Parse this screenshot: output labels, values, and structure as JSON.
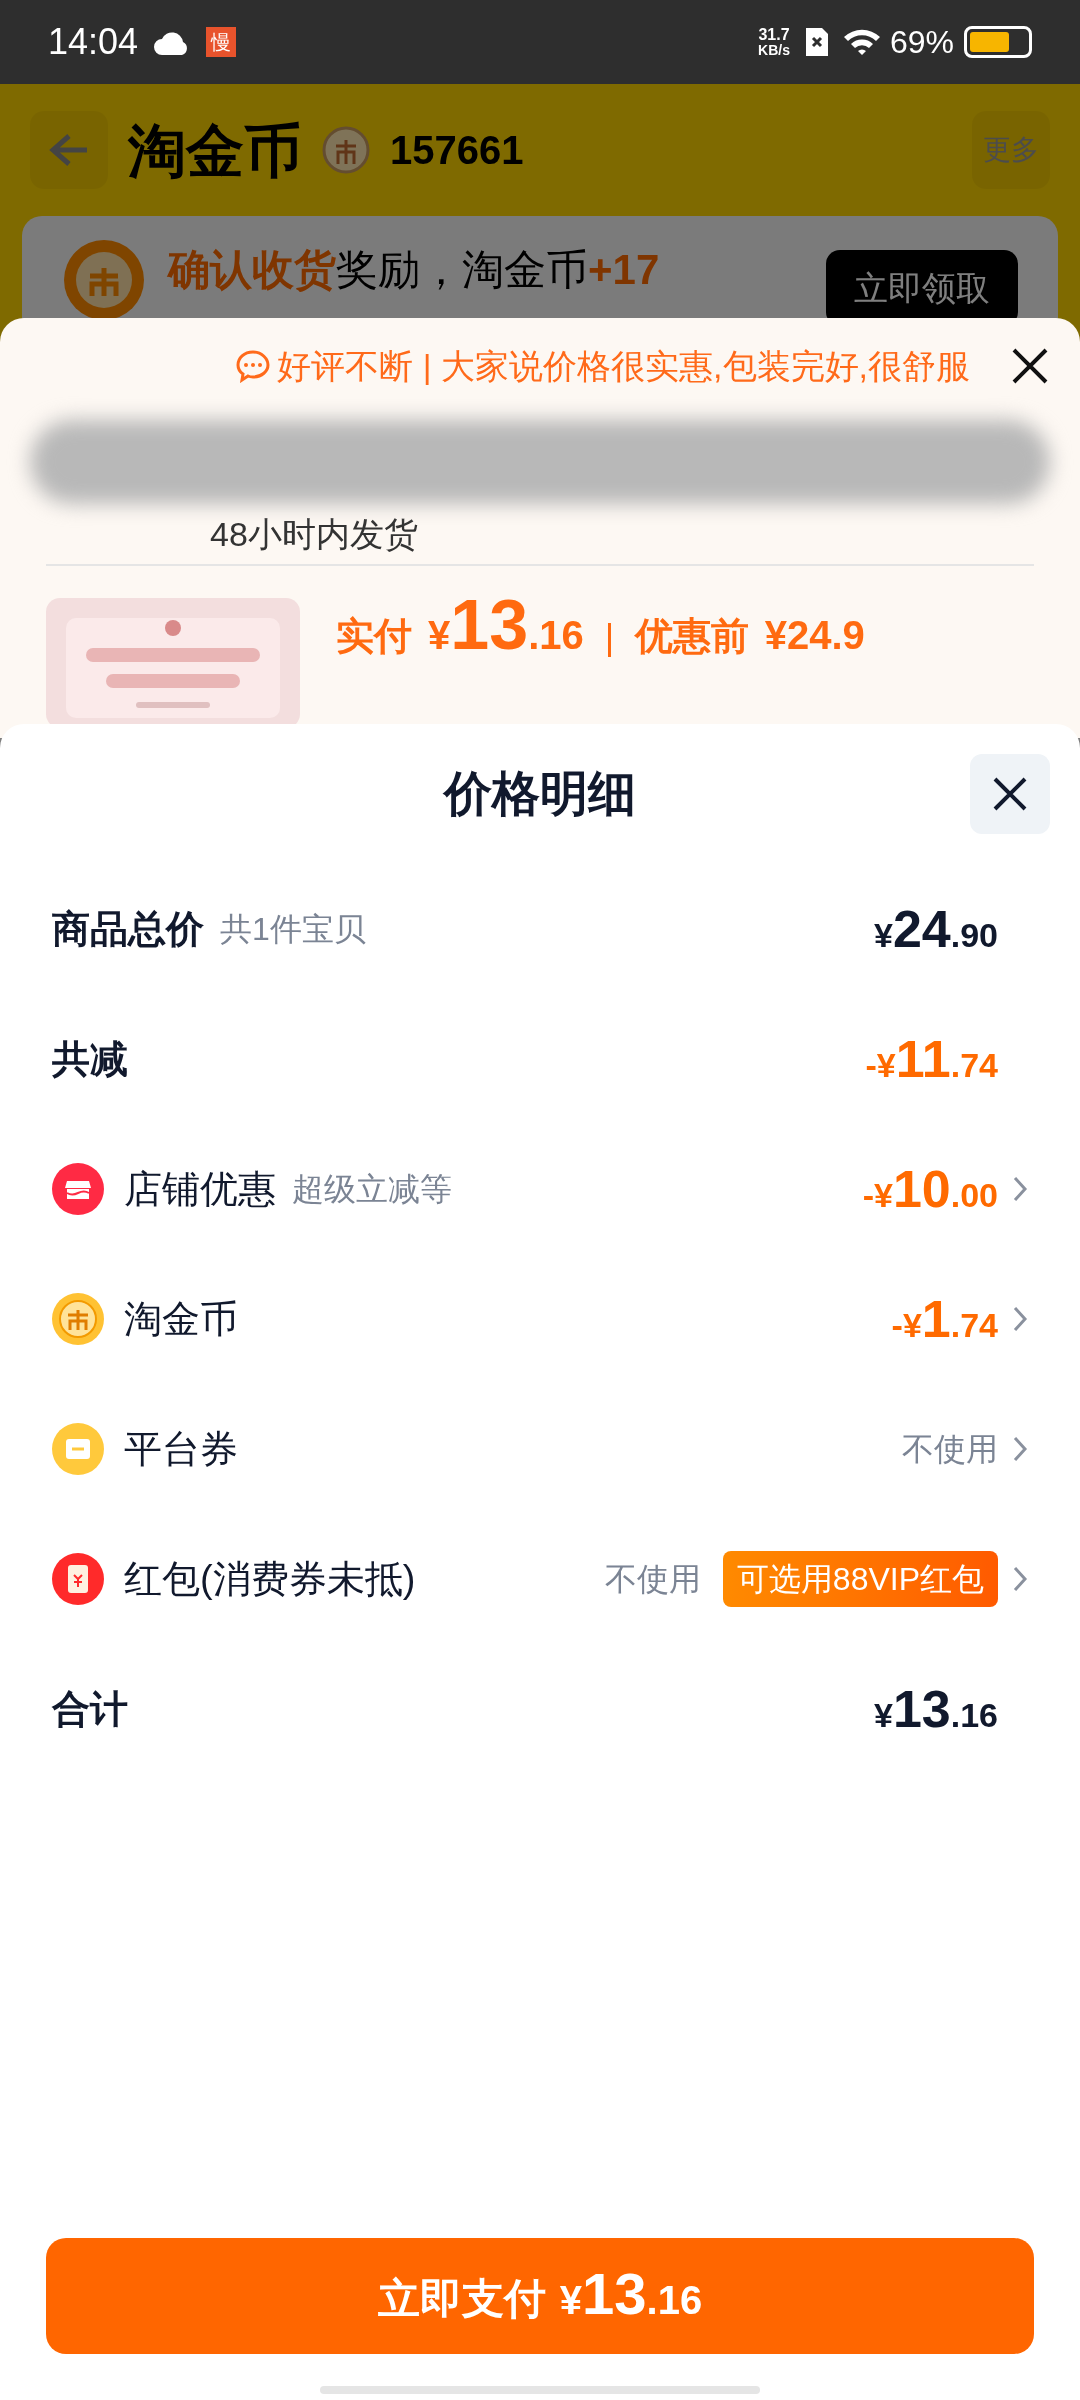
{
  "status_bar": {
    "time": "14:04",
    "app_badge": "慢",
    "net_speed": "31.7",
    "net_unit": "KB/s",
    "battery": "69%"
  },
  "page": {
    "title": "淘金币",
    "coins": "157661",
    "more": "更多",
    "reward": {
      "segments": [
        {
          "text": "确认收货",
          "accent": true
        },
        {
          "text": "奖励，淘金币",
          "accent": false
        },
        {
          "text": "+17",
          "accent": true
        }
      ],
      "button": "立即领取"
    }
  },
  "review_sheet": {
    "text": "好评不断 | 大家说价格很实惠,包装完好,很舒服",
    "shipping": "48小时内发货",
    "product": {
      "paid_label": "实付",
      "paid": "¥13.16",
      "before_label": "优惠前",
      "before": "¥24.9"
    }
  },
  "sheet": {
    "title": "价格明细",
    "rows": [
      {
        "kind": "sum",
        "label": "商品总价",
        "note": "共1件宝贝",
        "value": {
          "text": "¥24.90",
          "kind": "amount"
        },
        "chevron": false
      },
      {
        "kind": "sum",
        "label": "共减",
        "value": {
          "text": "-¥11.74",
          "kind": "deduction"
        },
        "chevron": false
      },
      {
        "kind": "option",
        "label": "店铺优惠",
        "note": "超级立减等",
        "value": {
          "text": "-¥10.00",
          "kind": "deduction"
        },
        "chevron": true
      },
      {
        "kind": "option",
        "label": "淘金币",
        "value": {
          "text": "-¥1.74",
          "kind": "deduction"
        },
        "chevron": true
      },
      {
        "kind": "option",
        "label": "平台券",
        "value": {
          "text": "不使用",
          "kind": "plain"
        },
        "chevron": true
      },
      {
        "kind": "option",
        "label": "红包(消费券未抵)",
        "value": {
          "text": "不使用",
          "kind": "plain"
        },
        "badge": "可选用88VIP红包",
        "chevron": true
      },
      {
        "kind": "sum",
        "label": "合计",
        "value": {
          "text": "¥13.16",
          "kind": "amount"
        },
        "chevron": false
      }
    ],
    "pay_button": {
      "label": "立即支付",
      "amount": "¥13.16"
    }
  }
}
